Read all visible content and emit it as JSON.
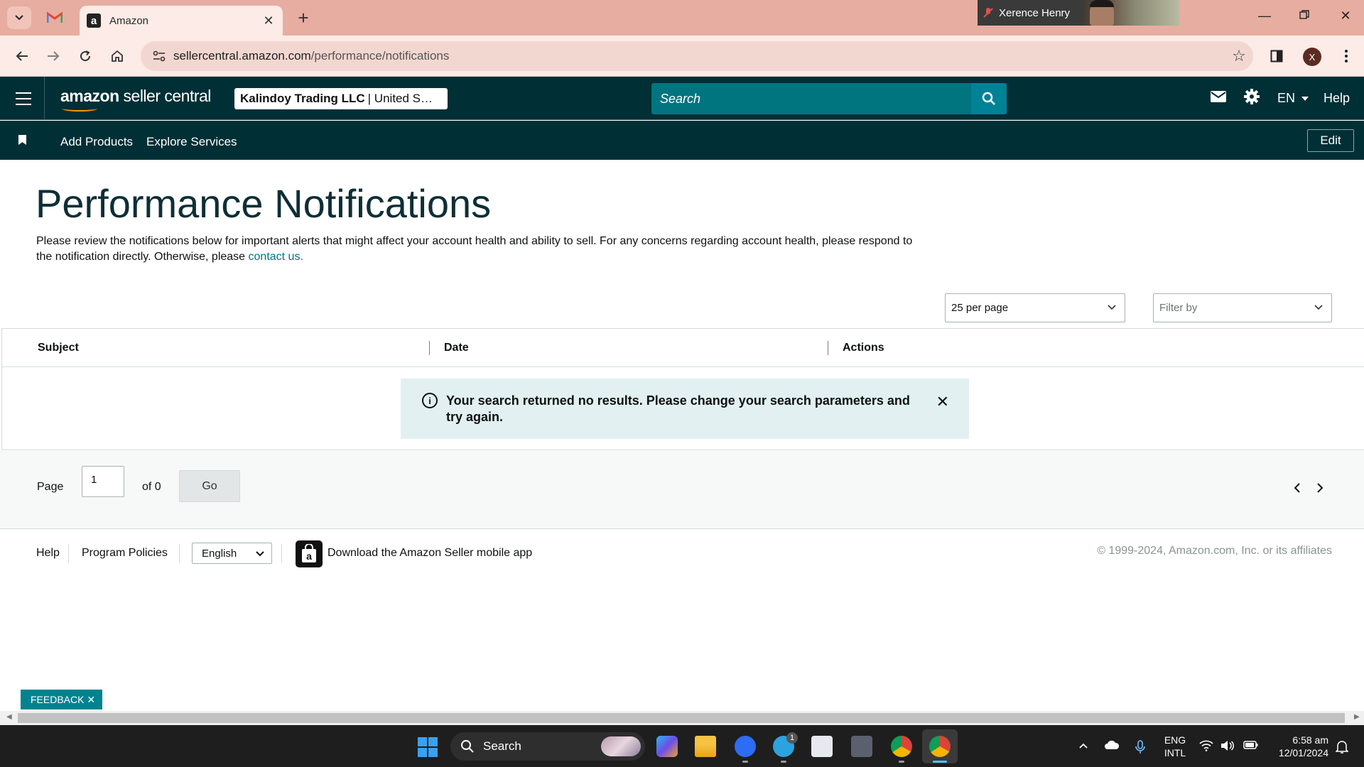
{
  "browser": {
    "active_tab_title": "Amazon",
    "tab_favicon_letter": "a",
    "video_call_name": "Xerence Henry",
    "url_domain": "sellercentral.amazon.com",
    "url_path": "/performance/notifications",
    "profile_initial": "X"
  },
  "header": {
    "logo_bold": "amazon",
    "logo_text": " seller central",
    "store_name": "Kalindoy Trading LLC",
    "store_region": "| United S…",
    "search_placeholder": "Search",
    "language": "EN",
    "help_label": "Help"
  },
  "subnav": {
    "links": [
      "Add Products",
      "Explore Services"
    ],
    "edit_label": "Edit"
  },
  "page": {
    "title": "Performance Notifications",
    "description": "Please review the notifications below for important alerts that might affect your account health and ability to sell. For any concerns regarding account health, please respond to the notification directly. Otherwise, please ",
    "contact_link": "contact us.",
    "per_page": "25 per page",
    "filter_placeholder": "Filter by"
  },
  "table": {
    "columns": [
      "Subject",
      "Date",
      "Actions"
    ],
    "empty_message": "Your search returned no results. Please change your search parameters and try again."
  },
  "pager": {
    "page_label": "Page",
    "current_page": "1",
    "of_label": "of 0",
    "go_label": "Go"
  },
  "footer": {
    "help": "Help",
    "program_policies": "Program Policies",
    "language": "English",
    "app_download": "Download the Amazon Seller mobile app",
    "copyright": "© 1999-2024, Amazon.com, Inc. or its affiliates"
  },
  "feedback_label": "FEEDBACK ✕",
  "taskbar": {
    "search_label": "Search",
    "lang_top": "ENG",
    "lang_bottom": "INTL",
    "time": "6:58 am",
    "date": "12/01/2024",
    "telegram_badge": "1"
  },
  "colors": {
    "header_bg": "#002f36",
    "search_bg": "#00747f",
    "link": "#007185",
    "alert_bg": "#e2f0f2",
    "feedback_bg": "#00838f"
  }
}
